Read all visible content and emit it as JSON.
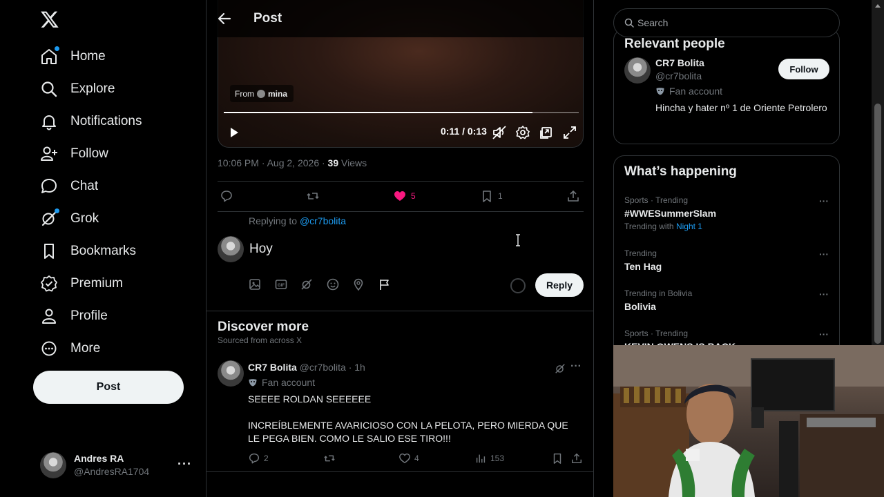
{
  "nav": {
    "items": [
      {
        "label": "Home",
        "icon": "home-icon",
        "dot": true
      },
      {
        "label": "Explore",
        "icon": "search-icon",
        "dot": false
      },
      {
        "label": "Notifications",
        "icon": "bell-icon",
        "dot": false
      },
      {
        "label": "Follow",
        "icon": "person-add-icon",
        "dot": false
      },
      {
        "label": "Chat",
        "icon": "chat-bubble-icon",
        "dot": false
      },
      {
        "label": "Grok",
        "icon": "grok-icon",
        "dot": true
      },
      {
        "label": "Bookmarks",
        "icon": "bookmark-icon",
        "dot": false
      },
      {
        "label": "Premium",
        "icon": "verified-badge-icon",
        "dot": false
      },
      {
        "label": "Profile",
        "icon": "person-icon",
        "dot": false
      },
      {
        "label": "More",
        "icon": "more-circle-icon",
        "dot": false
      }
    ],
    "post_button": "Post",
    "account": {
      "name": "Andres RA",
      "handle": "@AndresRA1704"
    }
  },
  "header": {
    "title": "Post"
  },
  "video": {
    "from_label": "From",
    "from_user": "mina",
    "time": "0:11 / 0:13",
    "progress_fraction": 0.87
  },
  "post_meta": {
    "time": "10:06 PM · Aug 2, 2026 · ",
    "views_count": "39",
    "views_label": " Views"
  },
  "post_actions": {
    "replies": "",
    "reposts": "",
    "likes": "5",
    "bookmarks": "1"
  },
  "compose": {
    "replying_to_label": "Replying to ",
    "replying_to_handle": "@cr7bolita",
    "value": "Hoy",
    "reply_button": "Reply"
  },
  "discover": {
    "title": "Discover more",
    "subtitle": "Sourced from across X"
  },
  "discover_tweet": {
    "name": "CR7 Bolita",
    "meta": " @cr7bolita · 1h",
    "badge": "Fan account",
    "text": "SEEEE ROLDAN SEEEEEE\n\nINCREÍBLEMENTE AVARICIOSO CON LA PELOTA, PERO MIERDA QUE LE PEGA BIEN. COMO LE SALIO ESE TIRO!!!",
    "replies": "2",
    "reposts": "",
    "likes": "4",
    "views": "153"
  },
  "search": {
    "placeholder": "Search"
  },
  "relevant": {
    "title": "Relevant people",
    "name": "CR7 Bolita",
    "handle": "@cr7bolita",
    "badge": "Fan account",
    "bio": "Hincha y hater nº 1 de Oriente Petrolero",
    "follow_button": "Follow"
  },
  "happening": {
    "title": "What’s happening",
    "trends": [
      {
        "context": "Sports · Trending",
        "name": "#WWESummerSlam",
        "with_label": "Trending with ",
        "with_link": "Night 1"
      },
      {
        "context": "Trending",
        "name": "Ten Hag",
        "with_label": "",
        "with_link": ""
      },
      {
        "context": "Trending in Bolivia",
        "name": "Bolivia",
        "with_label": "",
        "with_link": ""
      },
      {
        "context": "Sports · Trending",
        "name": "KEVIN OWENS IS BACK",
        "with_label": "",
        "with_link": ""
      }
    ]
  },
  "colors": {
    "accent": "#1d9bf0",
    "like": "#f91880",
    "background": "#000000",
    "border": "#2f3336",
    "muted": "#71767b"
  }
}
